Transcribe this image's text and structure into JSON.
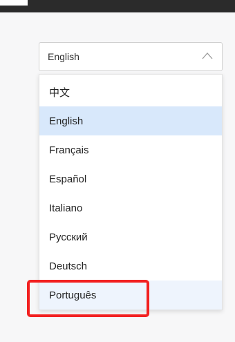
{
  "select": {
    "value": "English"
  },
  "dropdown": {
    "options": [
      {
        "label": "中文"
      },
      {
        "label": "English"
      },
      {
        "label": "Français"
      },
      {
        "label": "Español"
      },
      {
        "label": "Italiano"
      },
      {
        "label": "Русский"
      },
      {
        "label": "Deutsch"
      },
      {
        "label": "Português"
      }
    ],
    "selected_index": 1,
    "highlighted_index": 7
  },
  "colors": {
    "selected_bg": "#d8e8fb",
    "hover_bg": "#eef4fd",
    "annotation_red": "#f22020"
  },
  "icons": {
    "chevron": "chevron-up-icon"
  }
}
